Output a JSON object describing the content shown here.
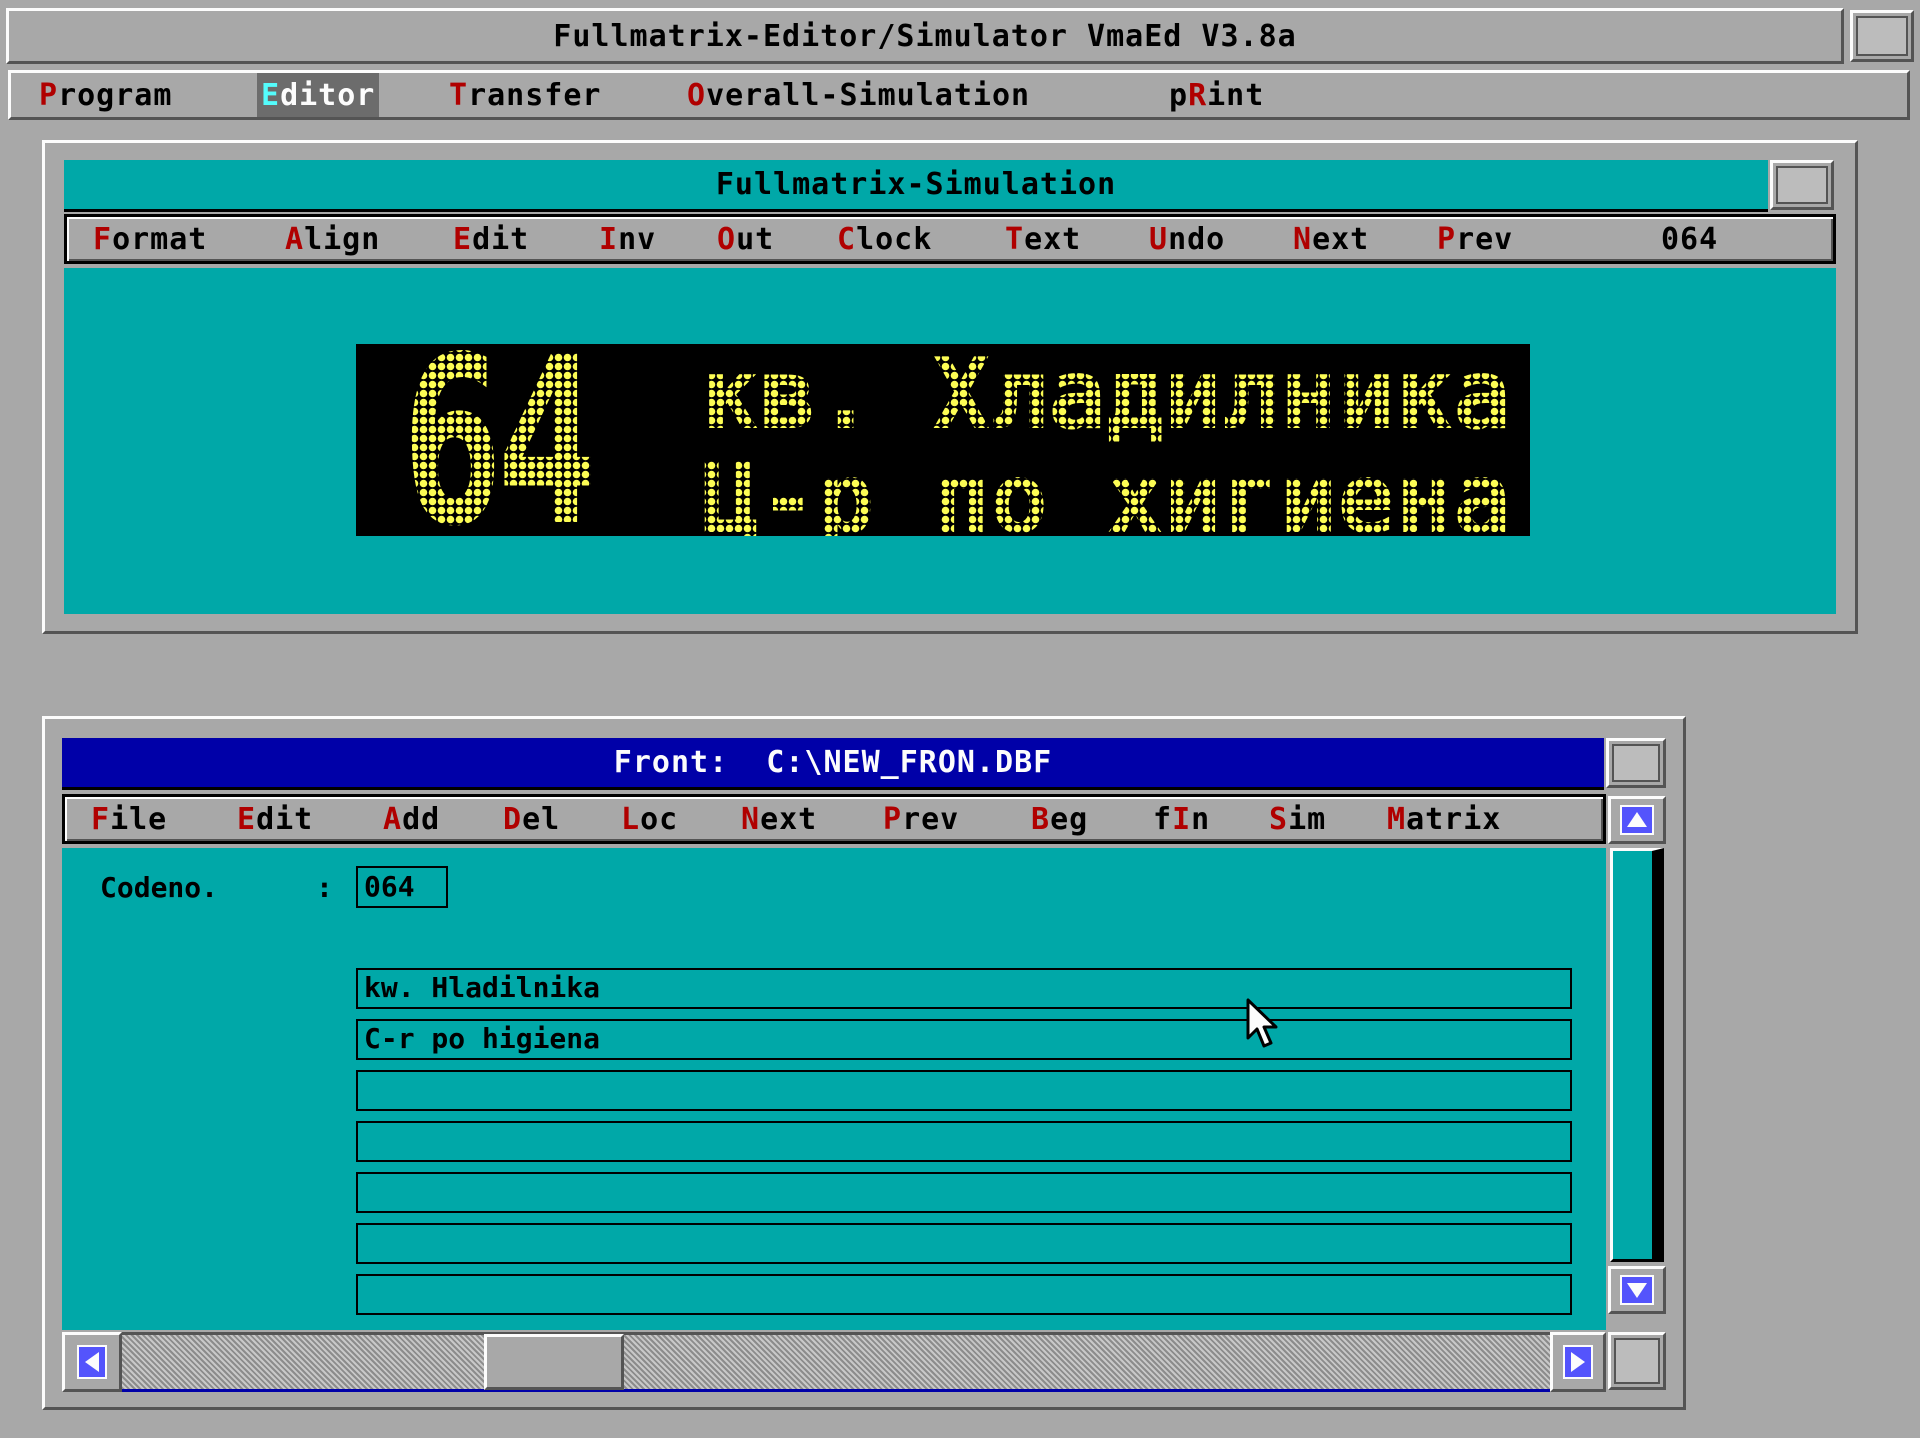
{
  "app": {
    "title": "Fullmatrix-Editor/Simulator VmaEd V3.8a",
    "menu": [
      {
        "hot": "P",
        "rest": "rogram"
      },
      {
        "hot": "E",
        "rest": "ditor",
        "selected": true
      },
      {
        "hot": "T",
        "rest": "ransfer"
      },
      {
        "hot": "O",
        "rest": "verall-Simulation"
      },
      {
        "pre": "p",
        "hot": "R",
        "rest": "int"
      }
    ]
  },
  "simulation": {
    "title": "Fullmatrix-Simulation",
    "menu": [
      {
        "hot": "F",
        "rest": "ormat"
      },
      {
        "hot": "A",
        "rest": "lign"
      },
      {
        "hot": "E",
        "rest": "dit"
      },
      {
        "hot": "I",
        "rest": "nv"
      },
      {
        "hot": "O",
        "rest": "ut"
      },
      {
        "hot": "C",
        "rest": "lock"
      },
      {
        "hot": "T",
        "rest": "ext"
      },
      {
        "hot": "U",
        "rest": "ndo"
      },
      {
        "hot": "N",
        "rest": "ext"
      },
      {
        "hot": "P",
        "rest": "rev"
      }
    ],
    "counter": "064",
    "display": {
      "route_number": "64",
      "line1": "кв. Хладилника",
      "line2": "Ц-р по хигиена",
      "led_color": "#fcfc54",
      "background": "#000000"
    }
  },
  "front": {
    "title": "Front:  C:\\NEW_FRON.DBF",
    "menu": [
      {
        "hot": "F",
        "rest": "ile"
      },
      {
        "hot": "E",
        "rest": "dit"
      },
      {
        "hot": "A",
        "rest": "dd"
      },
      {
        "hot": "D",
        "rest": "el"
      },
      {
        "hot": "L",
        "rest": "oc"
      },
      {
        "hot": "N",
        "rest": "ext"
      },
      {
        "hot": "P",
        "rest": "rev"
      },
      {
        "hot": "B",
        "rest": "eg"
      },
      {
        "pre": "f",
        "hot": "I",
        "rest": "n"
      },
      {
        "hot": "S",
        "rest": "im"
      },
      {
        "hot": "M",
        "rest": "atrix"
      }
    ],
    "codeno_label": "Codeno.",
    "codeno_separator": ":",
    "codeno_value": "064",
    "text_lines": [
      "kw. Hladilnika",
      "C-r po higiena",
      "",
      "",
      "",
      "",
      ""
    ],
    "horizontal_scroll_position": 0.11
  },
  "colors": {
    "desktop": "#a8a8a8",
    "panel": "#00a8a8",
    "active_titlebar": "#0000a8",
    "hotkey": "#b00000"
  },
  "icons": {
    "scroll_up": "triangle-up-icon",
    "scroll_down": "triangle-down-icon",
    "scroll_left": "triangle-left-icon",
    "scroll_right": "triangle-right-icon",
    "cursor": "mouse-pointer-icon"
  }
}
